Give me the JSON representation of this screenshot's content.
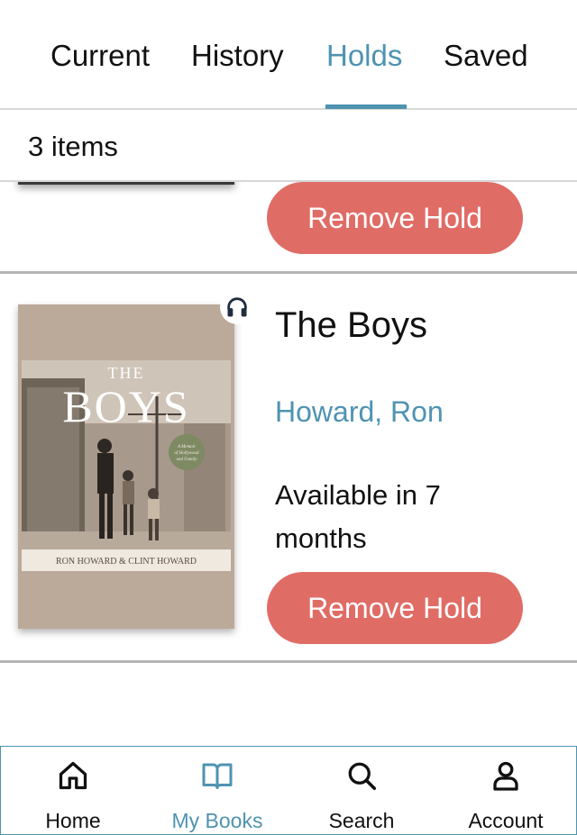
{
  "tabs": [
    {
      "label": "Current",
      "active": false
    },
    {
      "label": "History",
      "active": false
    },
    {
      "label": "Holds",
      "active": true
    },
    {
      "label": "Saved",
      "active": false
    }
  ],
  "summary": {
    "count_text": "3 items"
  },
  "partial_item": {
    "button_label": "Remove Hold"
  },
  "item": {
    "title": "The Boys",
    "author": "Howard, Ron",
    "status": "Available in 7 months",
    "button_label": "Remove Hold",
    "format_icon": "headphones-icon",
    "cover": {
      "title_line1": "THE",
      "title_line2": "BOYS",
      "authors": "RON HOWARD & CLINT HOWARD",
      "seal": "A Memoir of Hollywood and Family"
    }
  },
  "bottom_nav": [
    {
      "label": "Home",
      "icon": "home-icon",
      "active": false
    },
    {
      "label": "My Books",
      "icon": "book-icon",
      "active": true
    },
    {
      "label": "Search",
      "icon": "search-icon",
      "active": false
    },
    {
      "label": "Account",
      "icon": "account-icon",
      "active": false
    }
  ],
  "colors": {
    "accent": "#4f93b1",
    "button": "#e06c66",
    "cover_bg": "#bba99a"
  }
}
